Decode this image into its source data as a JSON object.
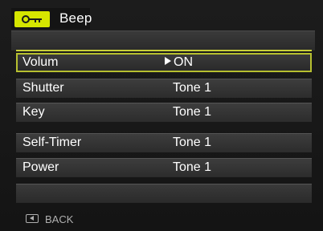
{
  "header": {
    "icon": "key-icon",
    "title": "Beep",
    "accent_color": "#d6e600"
  },
  "menu": {
    "items": [
      {
        "label": "Volum",
        "value": "ON",
        "selected": true
      },
      {
        "label": "Shutter",
        "value": "Tone 1",
        "selected": false
      },
      {
        "label": "Key",
        "value": "Tone 1",
        "selected": false
      },
      {
        "label": "Self-Timer",
        "value": "Tone 1",
        "selected": false
      },
      {
        "label": "Power",
        "value": "Tone 1",
        "selected": false
      }
    ]
  },
  "footer": {
    "icon": "back-button-icon",
    "back_label": "BACK"
  }
}
